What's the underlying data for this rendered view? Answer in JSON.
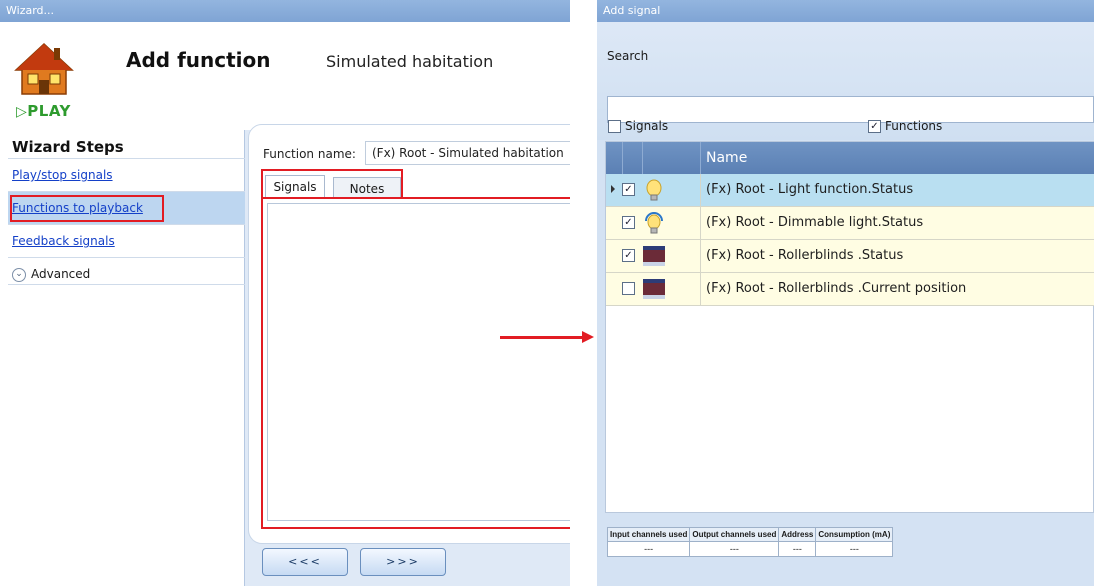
{
  "wizard": {
    "window_title": "Wizard...",
    "header": {
      "title": "Add function",
      "subtitle": "Simulated habitation",
      "logo_text": "PLAY"
    },
    "steps": {
      "title": "Wizard Steps",
      "items": [
        {
          "label": "Play/stop signals",
          "link": true,
          "selected": false
        },
        {
          "label": "Functions to playback",
          "link": true,
          "selected": true
        },
        {
          "label": "Feedback signals",
          "link": true,
          "selected": false
        },
        {
          "label": "Advanced",
          "link": false,
          "selected": false
        }
      ]
    },
    "form": {
      "function_name_label": "Function name:",
      "function_name_value": "(Fx) Root - Simulated habitation",
      "tabs": [
        {
          "label": "Signals",
          "active": true
        },
        {
          "label": "Notes",
          "active": false
        }
      ]
    },
    "nav": {
      "prev_label": "<<<",
      "next_label": ">>>"
    },
    "colors": {
      "highlight_red": "#e21c23",
      "link_blue": "#1440c8",
      "selected_step": "#bdd6f0"
    }
  },
  "add_signal": {
    "window_title": "Add signal",
    "search": {
      "label": "Search",
      "value": ""
    },
    "filters": {
      "signals": {
        "label": "Signals",
        "checked": false
      },
      "functions": {
        "label": "Functions",
        "checked": true
      }
    },
    "grid": {
      "column_name": "Name",
      "rows": [
        {
          "name": "(Fx) Root - Light function.Status",
          "checked": true,
          "icon": "light-bulb-icon",
          "selected": true
        },
        {
          "name": "(Fx) Root - Dimmable light.Status",
          "checked": true,
          "icon": "dimmable-bulb-icon",
          "selected": false
        },
        {
          "name": "(Fx) Root - Rollerblinds .Status",
          "checked": true,
          "icon": "rollerblind-icon",
          "selected": false
        },
        {
          "name": "(Fx) Root - Rollerblinds .Current position",
          "checked": false,
          "icon": "rollerblind-icon",
          "selected": false
        }
      ]
    },
    "status": {
      "headers": [
        "Input channels used",
        "Output channels used",
        "Address",
        "Consumption (mA)"
      ],
      "values": [
        "---",
        "---",
        "---",
        "---"
      ]
    }
  }
}
